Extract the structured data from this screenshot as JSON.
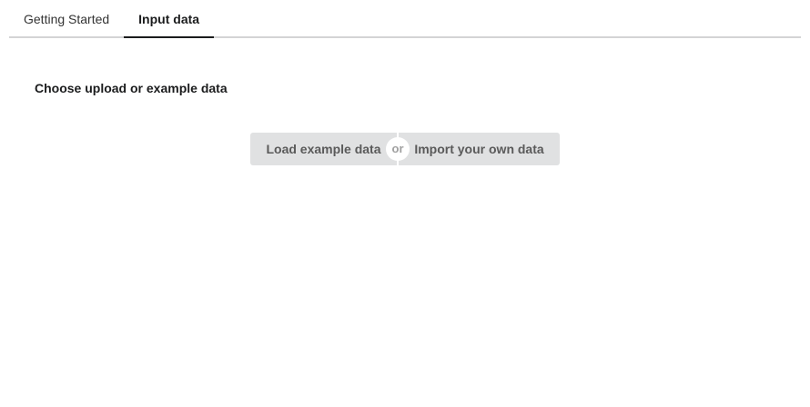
{
  "tabs": [
    {
      "label": "Getting Started",
      "active": false
    },
    {
      "label": "Input data",
      "active": true
    }
  ],
  "main": {
    "heading": "Choose upload or example data",
    "load_example_label": "Load example data",
    "or_label": "or",
    "import_label": "Import your own data"
  },
  "colors": {
    "button_bg": "#e0e1e2",
    "button_text": "#5a5a5a",
    "tab_underline": "#1b1c1d",
    "tab_bar_border": "#d4d4d5"
  }
}
